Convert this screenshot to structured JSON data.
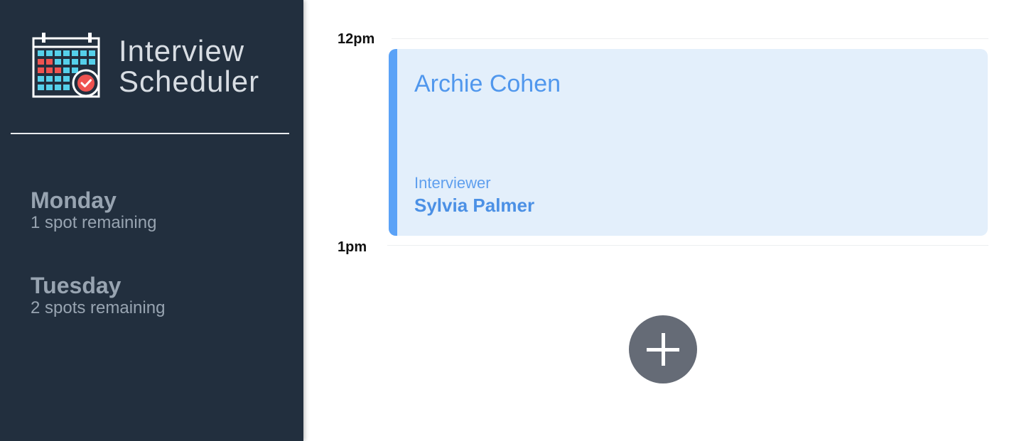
{
  "app": {
    "title_line1": "Interview",
    "title_line2": "Scheduler",
    "logo_icon": "calendar-check-icon"
  },
  "sidebar": {
    "days": [
      {
        "name": "Monday",
        "spots": "1 spot remaining"
      },
      {
        "name": "Tuesday",
        "spots": "2 spots remaining"
      }
    ]
  },
  "schedule": {
    "times": [
      "12pm",
      "1pm"
    ],
    "appointment": {
      "student": "Archie Cohen",
      "interviewer_label": "Interviewer",
      "interviewer": "Sylvia Palmer"
    },
    "add_icon": "plus-icon"
  },
  "colors": {
    "sidebar_bg": "#222f3e",
    "appointment_bg": "#e3effb",
    "accent": "#5aa2f7",
    "add_button": "#656b76"
  }
}
